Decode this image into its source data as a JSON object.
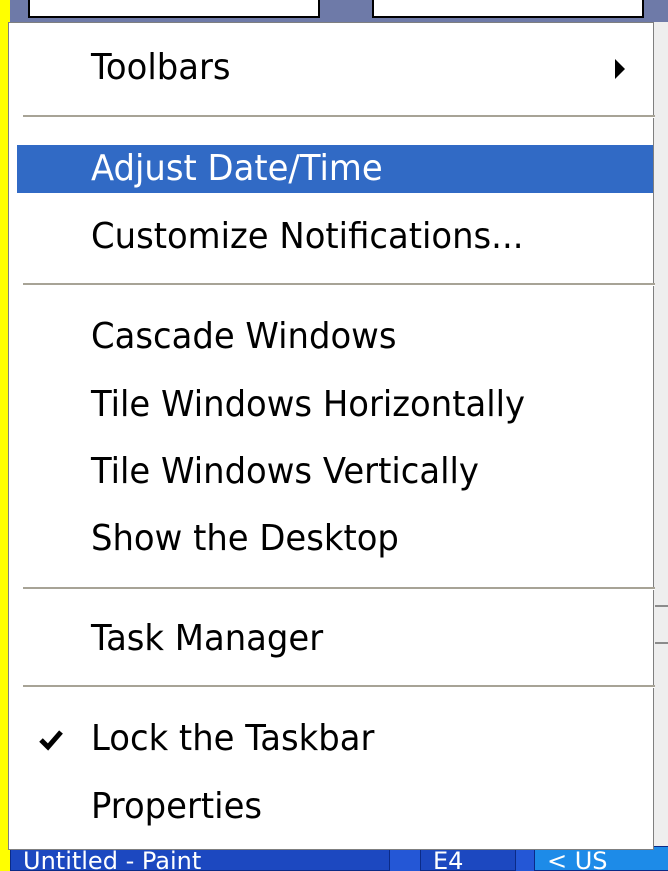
{
  "menu": {
    "items": [
      {
        "label": "Toolbars",
        "has_submenu": true
      },
      {
        "label": "Adjust Date/Time",
        "highlighted": true
      },
      {
        "label": "Customize Notifications..."
      },
      {
        "label": "Cascade Windows"
      },
      {
        "label": "Tile Windows Horizontally"
      },
      {
        "label": "Tile Windows Vertically"
      },
      {
        "label": "Show the Desktop"
      },
      {
        "label": "Task Manager"
      },
      {
        "label": "Lock the Taskbar",
        "checked": true
      },
      {
        "label": "Properties"
      }
    ]
  },
  "taskbar": {
    "paint_button": "Untitled - Paint",
    "other_button": "E4",
    "tray_text": "< US"
  },
  "colors": {
    "highlight": "#316ac5",
    "background": "#ffff00",
    "taskbar": "#2457d6",
    "separator": "#a7a396"
  },
  "icons": {
    "submenu_arrow": "triangle-right-icon",
    "check": "checkmark-icon"
  }
}
